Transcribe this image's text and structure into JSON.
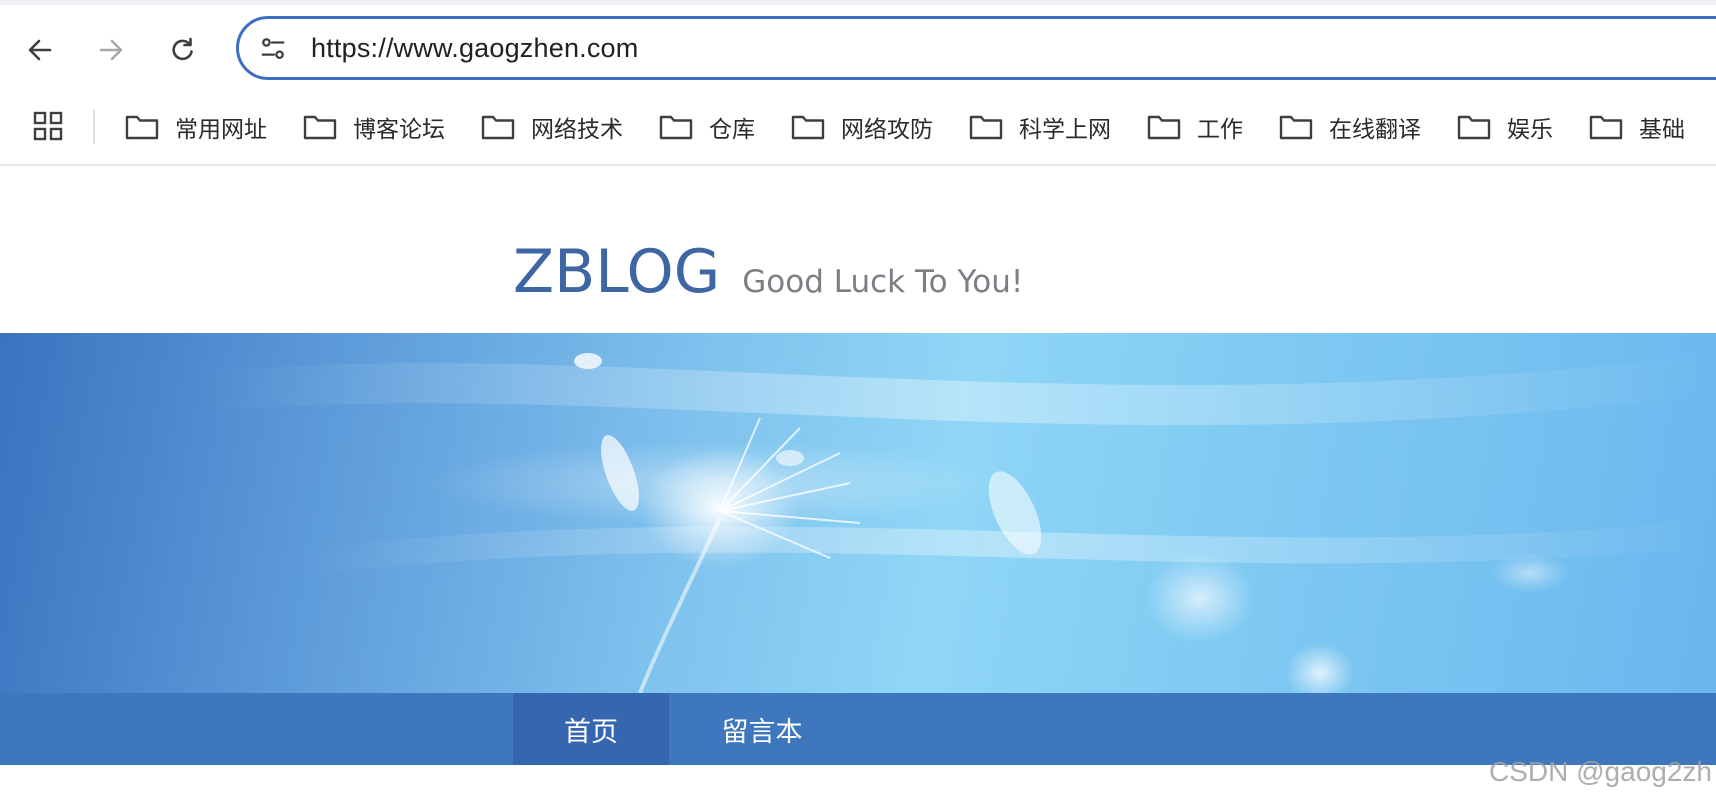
{
  "browser": {
    "url": "https://www.gaogzhen.com",
    "icons": {
      "back": "arrow-left-icon",
      "forward": "arrow-right-icon",
      "reload": "reload-icon",
      "site_settings": "tune-icon",
      "apps": "apps-grid-icon",
      "folder": "folder-icon"
    },
    "bookmarks": [
      {
        "label": "常用网址"
      },
      {
        "label": "博客论坛"
      },
      {
        "label": "网络技术"
      },
      {
        "label": "仓库"
      },
      {
        "label": "网络攻防"
      },
      {
        "label": "科学上网"
      },
      {
        "label": "工作"
      },
      {
        "label": "在线翻译"
      },
      {
        "label": "娱乐"
      },
      {
        "label": "基础"
      }
    ]
  },
  "site": {
    "title": "ZBLOG",
    "tagline": "Good Luck To You!",
    "colors": {
      "title": "#3d66a3",
      "nav_bar": "#3f77bf",
      "nav_active": "#3766b0",
      "url_focus": "#3c6ec6"
    },
    "nav": [
      {
        "label": "首页",
        "active": true
      },
      {
        "label": "留言本",
        "active": false
      }
    ]
  },
  "watermark": "CSDN @gaog2zh"
}
